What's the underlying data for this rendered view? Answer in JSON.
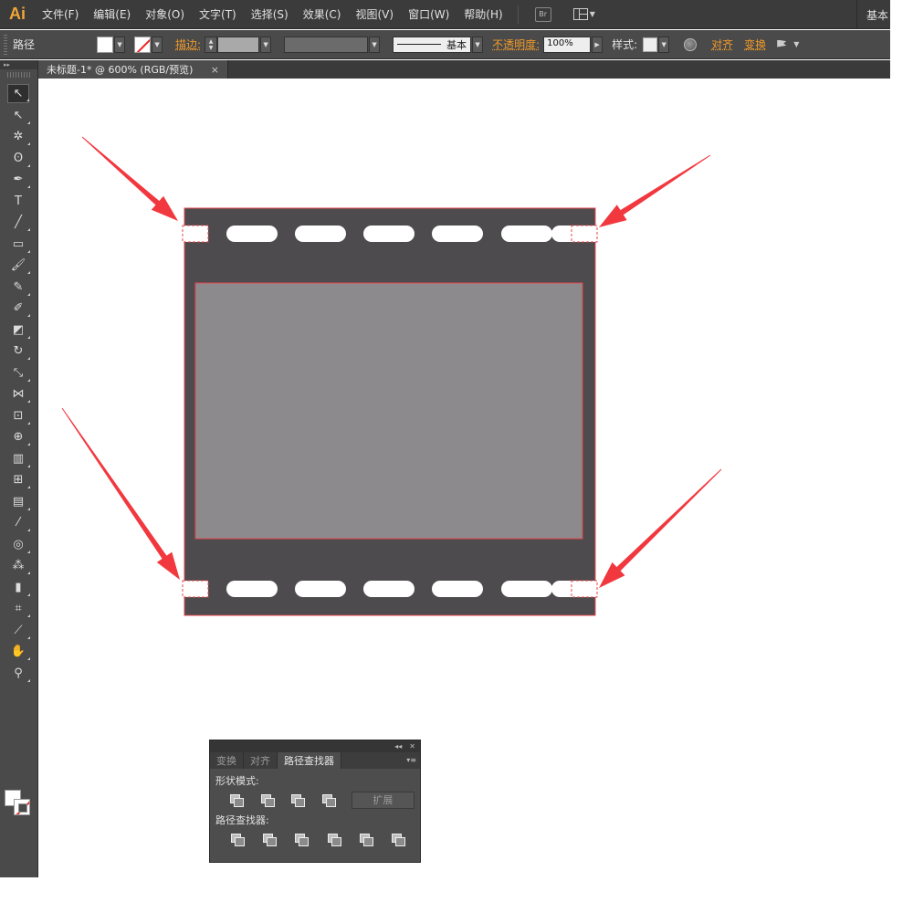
{
  "app": {
    "logo": "Ai",
    "menu": [
      "文件(F)",
      "编辑(E)",
      "对象(O)",
      "文字(T)",
      "选择(S)",
      "效果(C)",
      "视图(V)",
      "窗口(W)",
      "帮助(H)"
    ],
    "bridge_label": "Br",
    "workspace_label": "基本"
  },
  "control_bar": {
    "selection_label": "路径",
    "stroke_label": "描边:",
    "stroke_profile_label": "基本",
    "opacity_label": "不透明度:",
    "opacity_value": "100%",
    "style_label": "样式:",
    "align_label": "对齐",
    "transform_label": "变换"
  },
  "document": {
    "tab_title": "未标题-1* @ 600% (RGB/预览)",
    "close_glyph": "×"
  },
  "artwork": {
    "frame_color": "#4d4b4d",
    "inner_color": "#8c8a8c",
    "hole_color": "#ffffff",
    "selection_color": "#e5474e",
    "arrow_color": "#f2383f",
    "sprocket_holes_per_row": 6
  },
  "tools": [
    {
      "name": "selection-tool-icon",
      "glyph": "↖"
    },
    {
      "name": "direct-selection-tool-icon",
      "glyph": "↖"
    },
    {
      "name": "magic-wand-tool-icon",
      "glyph": "✲"
    },
    {
      "name": "lasso-tool-icon",
      "glyph": "ʘ"
    },
    {
      "name": "pen-tool-icon",
      "glyph": "✒"
    },
    {
      "name": "type-tool-icon",
      "glyph": "T"
    },
    {
      "name": "line-tool-icon",
      "glyph": "╱"
    },
    {
      "name": "rectangle-tool-icon",
      "glyph": "▭"
    },
    {
      "name": "paintbrush-tool-icon",
      "glyph": "🖌"
    },
    {
      "name": "pencil-tool-icon",
      "glyph": "✎"
    },
    {
      "name": "blob-brush-tool-icon",
      "glyph": "✐"
    },
    {
      "name": "eraser-tool-icon",
      "glyph": "◩"
    },
    {
      "name": "rotate-tool-icon",
      "glyph": "↻"
    },
    {
      "name": "scale-tool-icon",
      "glyph": "⤡"
    },
    {
      "name": "width-tool-icon",
      "glyph": "⋈"
    },
    {
      "name": "free-transform-tool-icon",
      "glyph": "⊡"
    },
    {
      "name": "shape-builder-tool-icon",
      "glyph": "⊕"
    },
    {
      "name": "perspective-grid-tool-icon",
      "glyph": "▥"
    },
    {
      "name": "mesh-tool-icon",
      "glyph": "⊞"
    },
    {
      "name": "gradient-tool-icon",
      "glyph": "▤"
    },
    {
      "name": "eyedropper-tool-icon",
      "glyph": "⁄"
    },
    {
      "name": "blend-tool-icon",
      "glyph": "◎"
    },
    {
      "name": "symbol-sprayer-tool-icon",
      "glyph": "⁂"
    },
    {
      "name": "column-graph-tool-icon",
      "glyph": "▮"
    },
    {
      "name": "artboard-tool-icon",
      "glyph": "⌗"
    },
    {
      "name": "slice-tool-icon",
      "glyph": "⟋"
    },
    {
      "name": "hand-tool-icon",
      "glyph": "✋"
    },
    {
      "name": "zoom-tool-icon",
      "glyph": "⚲"
    }
  ],
  "pathfinder_panel": {
    "tabs": [
      "变换",
      "对齐",
      "路径查找器"
    ],
    "shape_modes_label": "形状模式:",
    "expand_label": "扩展",
    "pathfinders_label": "路径查找器:",
    "shape_mode_buttons": [
      "unite-button",
      "minus-front-button",
      "intersect-button",
      "exclude-button"
    ],
    "pathfinder_buttons": [
      "divide-button",
      "trim-button",
      "merge-button",
      "crop-button",
      "outline-button",
      "minus-back-button"
    ]
  }
}
